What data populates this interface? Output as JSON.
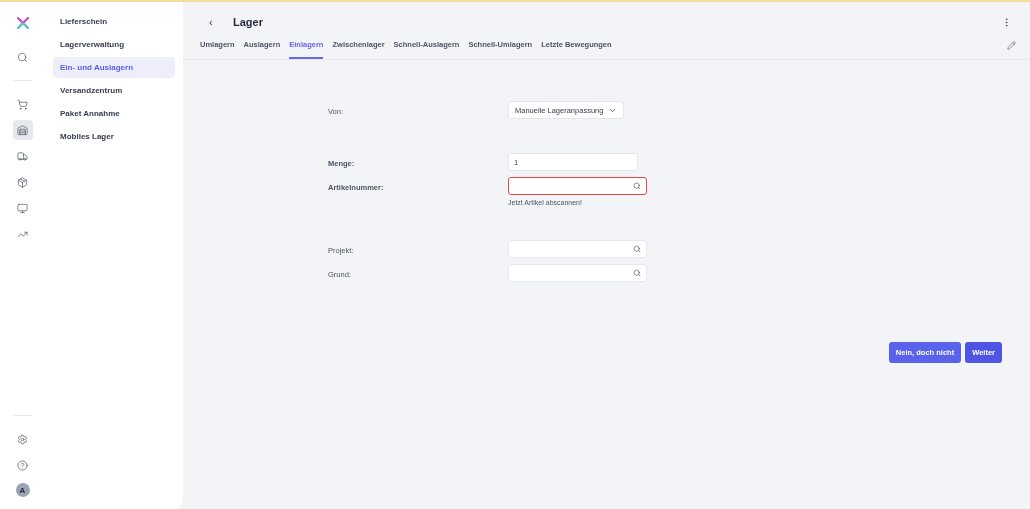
{
  "rail": {
    "top": [
      {
        "kind": "logo"
      },
      {
        "kind": "search"
      }
    ],
    "items": [
      {
        "kind": "cart",
        "selected": false
      },
      {
        "kind": "warehouse",
        "selected": true
      },
      {
        "kind": "dolly",
        "selected": false
      },
      {
        "kind": "box",
        "selected": false
      },
      {
        "kind": "monitor",
        "selected": false
      },
      {
        "kind": "chart",
        "selected": false
      }
    ],
    "bottom": [
      {
        "kind": "settings"
      },
      {
        "kind": "help"
      }
    ],
    "avatar": "A"
  },
  "submenu": [
    {
      "label": "Lieferschein",
      "selected": false
    },
    {
      "label": "Lagerverwaltung",
      "selected": false
    },
    {
      "label": "Ein- und Auslagern",
      "selected": true
    },
    {
      "label": "Versandzentrum",
      "selected": false
    },
    {
      "label": "Paket Annahme",
      "selected": false
    },
    {
      "label": "Mobiles Lager",
      "selected": false
    }
  ],
  "header": {
    "title": "Lager",
    "back": "‹"
  },
  "tabs": [
    {
      "label": "Umlagern",
      "selected": false
    },
    {
      "label": "Auslagern",
      "selected": false
    },
    {
      "label": "Einlagern",
      "selected": true
    },
    {
      "label": "Zwischenlager",
      "selected": false
    },
    {
      "label": "Schnell-Auslagern",
      "selected": false
    },
    {
      "label": "Schnell-Umlagern",
      "selected": false
    },
    {
      "label": "Letzte Bewegungen",
      "selected": false
    }
  ],
  "form_sections": [
    [
      {
        "label": "Von:",
        "kind": "select",
        "value": "Manuelle Lageranpassung",
        "required": false,
        "invalid": false
      }
    ],
    [
      {
        "label": "Menge:",
        "kind": "text",
        "value": "1",
        "required": true,
        "invalid": false
      },
      {
        "label": "Artikelnummer:",
        "kind": "search",
        "required": true,
        "invalid": true,
        "hint": "Jetzt Artikel abscannen!"
      }
    ],
    [
      {
        "label": "Projekt:",
        "kind": "search",
        "required": false,
        "invalid": false
      },
      {
        "label": "Grund:",
        "kind": "search",
        "required": false,
        "invalid": false
      }
    ]
  ],
  "buttons": [
    {
      "label": "Nein, doch nicht",
      "kind": "secondary"
    },
    {
      "label": "Weiter",
      "kind": "primary"
    }
  ]
}
